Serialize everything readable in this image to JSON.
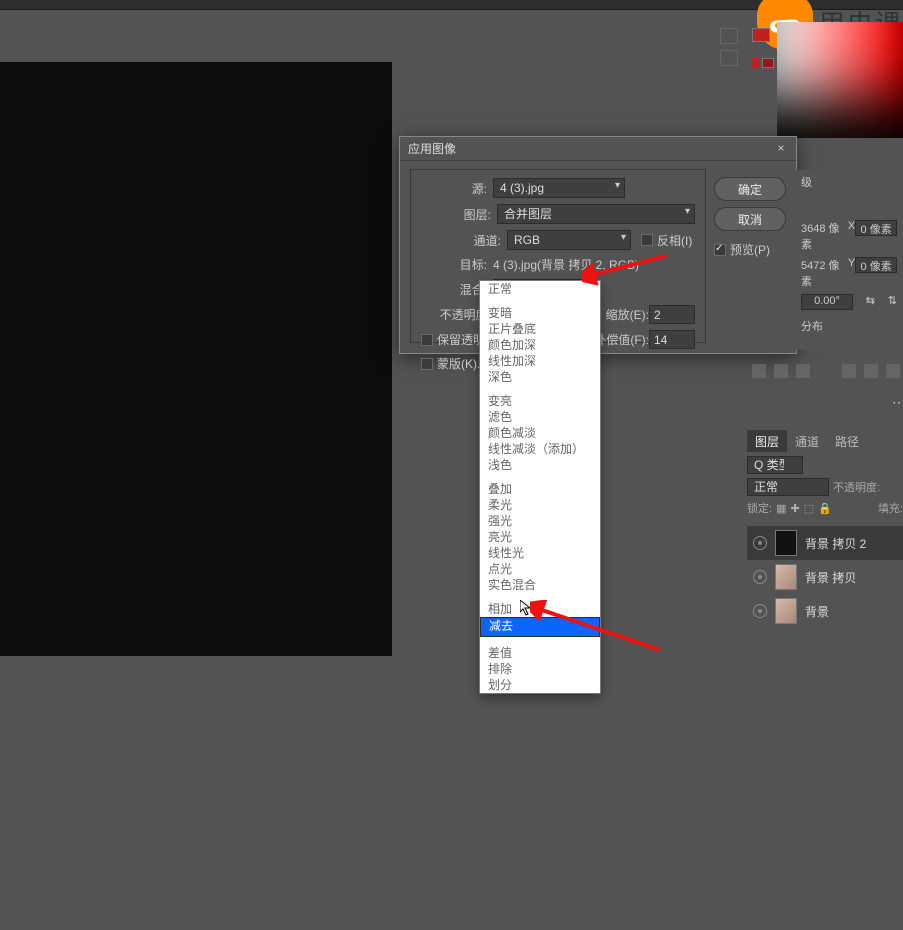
{
  "watermark": {
    "text": "甲虫课"
  },
  "dialog": {
    "title": "应用图像",
    "source_lbl": "源:",
    "source_val": "4 (3).jpg",
    "layer_lbl": "图层:",
    "layer_val": "合并图层",
    "channel_lbl": "通道:",
    "channel_val": "RGB",
    "invert_lbl": "反相(I)",
    "target_lbl": "目标:",
    "target_val": "4 (3).jpg(背景 拷贝 2, RGB)",
    "blend_lbl": "混合:",
    "blend_val": "减去",
    "opacity_lbl": "不透明度(O",
    "scale_lbl": "缩放(E):",
    "scale_val": "2",
    "offset_lbl": "补偿值(F):",
    "offset_val": "14",
    "preserve_lbl": "保留透明",
    "mask_lbl": "蒙版(K)...",
    "ok": "确定",
    "cancel": "取消",
    "preview": "预览(P)"
  },
  "blend_options": [
    "正常",
    "",
    "变暗",
    "正片叠底",
    "颜色加深",
    "线性加深",
    "深色",
    "",
    "变亮",
    "滤色",
    "颜色减淡",
    "线性减淡（添加）",
    "浅色",
    "",
    "叠加",
    "柔光",
    "强光",
    "亮光",
    "线性光",
    "点光",
    "实色混合",
    "",
    "相加",
    "减去",
    "",
    "差值",
    "排除",
    "划分"
  ],
  "blend_selected_index": 23,
  "info": {
    "w_lbl": "3648 像素",
    "x_lbl": "X",
    "x_val": "0 像素",
    "h_lbl": "5472 像素",
    "y_lbl": "Y",
    "y_val": "0 像素",
    "angle": "0.00°",
    "dist": "分布"
  },
  "panel": {
    "tabs": [
      "图层",
      "通道",
      "路径"
    ],
    "kind_lbl": "Q 类型",
    "mode_val": "正常",
    "opacity_lbl": "不透明度:",
    "lock_lbl": "锁定:",
    "fill_lbl": "填充:"
  },
  "layers": [
    {
      "name": "背景 拷贝 2",
      "thumb": "dark",
      "active": true
    },
    {
      "name": "背景 拷贝",
      "thumb": "img",
      "active": false
    },
    {
      "name": "背景",
      "thumb": "img",
      "active": false
    }
  ]
}
